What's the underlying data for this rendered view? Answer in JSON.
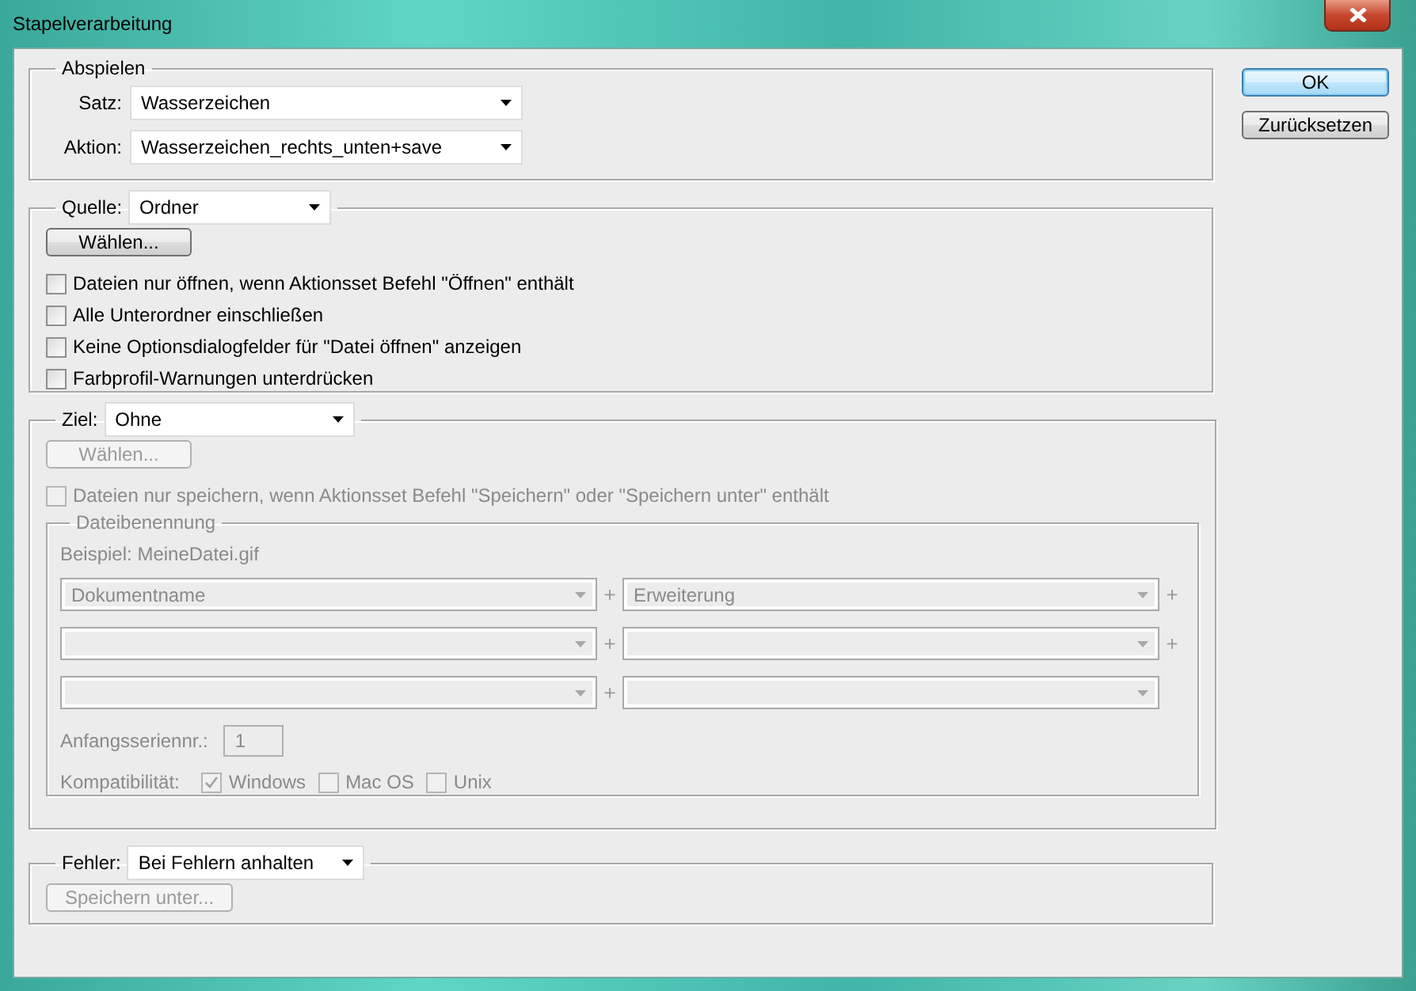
{
  "window": {
    "title": "Stapelverarbeitung"
  },
  "play": {
    "legend": "Abspielen",
    "fields": [
      {
        "label": "Satz:",
        "value": "Wasserzeichen"
      },
      {
        "label": "Aktion:",
        "value": "Wasserzeichen_rechts_unten+save"
      }
    ]
  },
  "source": {
    "label": "Quelle:",
    "value": "Ordner",
    "button": {
      "label": "Wählen...",
      "disabled": false
    },
    "options": [
      {
        "label": "Dateien nur öffnen, wenn Aktionsset Befehl \"Öffnen\" enthält",
        "checked": false,
        "disabled": false
      },
      {
        "label": "Alle Unterordner einschließen",
        "checked": false,
        "disabled": false
      },
      {
        "label": "Keine Optionsdialogfelder für \"Datei öffnen\" anzeigen",
        "checked": false,
        "disabled": false
      },
      {
        "label": "Farbprofil-Warnungen unterdrücken",
        "checked": false,
        "disabled": false
      }
    ]
  },
  "destination": {
    "label": "Ziel:",
    "value": "Ohne",
    "button": {
      "label": "Wählen...",
      "disabled": true
    },
    "options": [
      {
        "label": "Dateien nur speichern, wenn Aktionsset Befehl \"Speichern\" oder \"Speichern unter\" enthält",
        "checked": false,
        "disabled": true
      }
    ],
    "naming": {
      "legend": "Dateibenennung",
      "disabled": true,
      "example": "Beispiel: MeineDatei.gif",
      "rows": [
        [
          {
            "value": "Dokumentname",
            "plus": "+"
          },
          {
            "value": "Erweiterung",
            "plus": "+"
          }
        ],
        [
          {
            "plus": "+"
          },
          {
            "plus": "+"
          }
        ],
        [
          {
            "plus": "+"
          },
          {}
        ]
      ],
      "serial": {
        "label": "Anfangsseriennr.:",
        "value": "1"
      },
      "compat": {
        "label": "Kompatibilität:",
        "options": [
          {
            "label": "Windows",
            "checked": true
          },
          {
            "label": "Mac OS",
            "checked": false
          },
          {
            "label": "Unix",
            "checked": false
          }
        ]
      }
    }
  },
  "errors": {
    "label": "Fehler:",
    "value": "Bei Fehlern anhalten",
    "button": {
      "label": "Speichern unter...",
      "disabled": true
    }
  },
  "buttons": [
    {
      "label": "OK",
      "default": true
    },
    {
      "label": "Zurücksetzen",
      "default": false
    }
  ]
}
